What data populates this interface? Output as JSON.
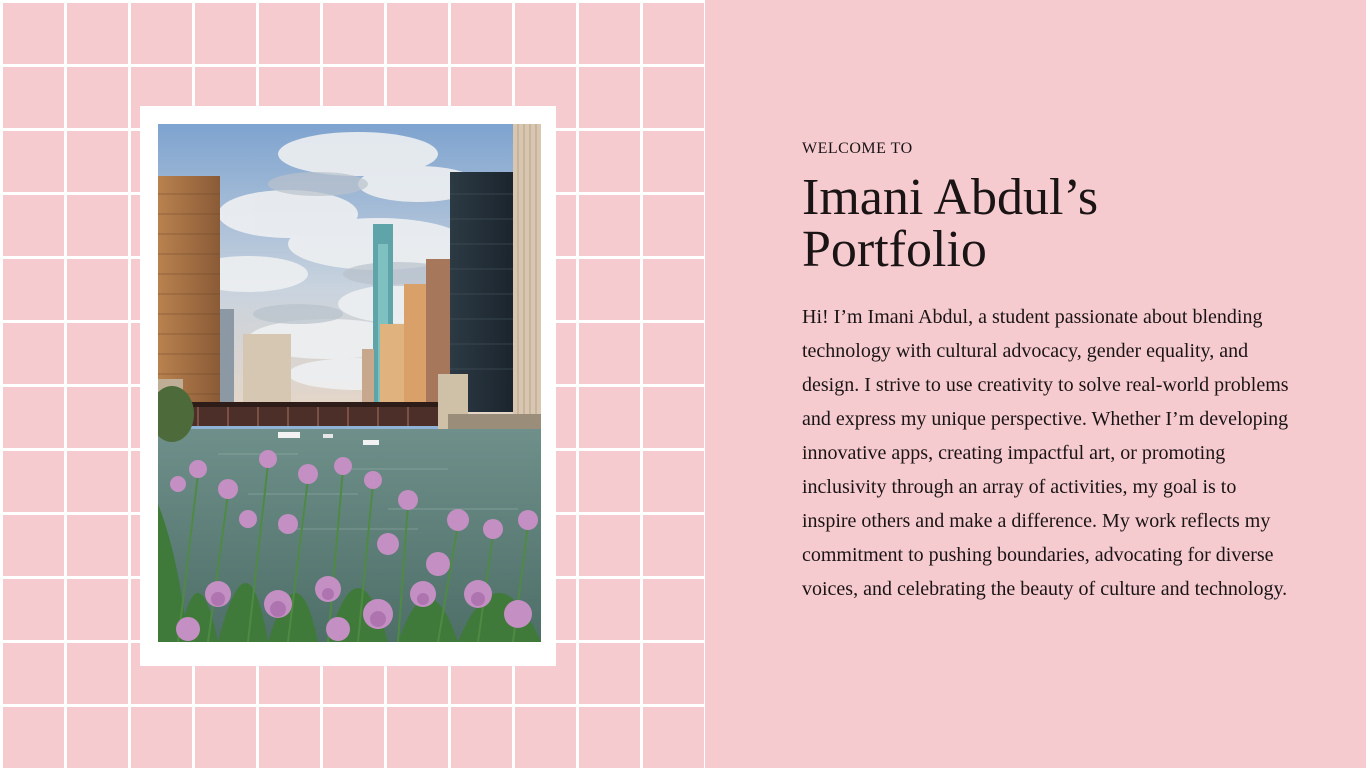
{
  "photo": {
    "description_icon": "chicago-river-photo"
  },
  "header": {
    "kicker": "WELCOME TO",
    "title_line1": "Imani Abdul’s",
    "title_line2": "Portfolio"
  },
  "bio": {
    "text": "Hi! I’m Imani Abdul, a student passionate about blending technology with cultural advocacy, gender equality, and design. I strive to use creativity to solve real-world problems and express my unique perspective. Whether I’m developing innovative apps, creating impactful art, or promoting inclusivity through an array of activities, my goal is to inspire others and make a difference. My work reflects my commitment to pushing boundaries, advocating for diverse voices, and celebrating the beauty of culture and technology."
  },
  "colors": {
    "background": "#f6cbd0",
    "grid_lines": "#ffffff",
    "text": "#1a1414"
  }
}
